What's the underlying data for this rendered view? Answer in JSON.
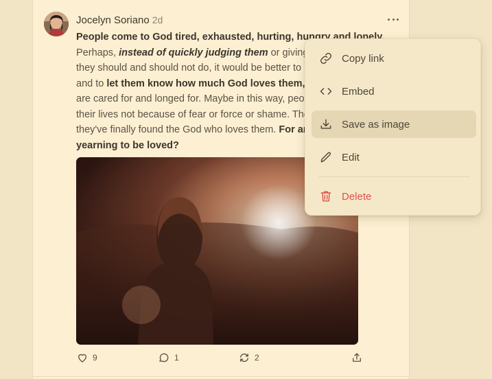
{
  "post": {
    "author": "Jocelyn Soriano",
    "time": "2d",
    "lines": [
      [
        {
          "t": "People come to God tired, exhausted, hurting, hungry and lonely.",
          "b": true,
          "i": false
        }
      ],
      [
        {
          "t": "Perhaps, ",
          "b": false,
          "i": false
        },
        {
          "t": "instead of quickly judging them",
          "b": true,
          "i": true
        },
        {
          "t": " or giving",
          "b": false,
          "i": false
        }
      ],
      [
        {
          "t": "they should and should not do, it would be better to",
          "b": false,
          "i": false
        }
      ],
      [
        {
          "t": "and to ",
          "b": false,
          "i": false
        },
        {
          "t": "let them know how much God loves them,",
          "b": true,
          "i": false
        }
      ],
      [
        {
          "t": "are cared for and longed for. Maybe in this way, peo",
          "b": false,
          "i": false
        }
      ],
      [
        {
          "t": "their lives not because of fear or force or shame. The",
          "b": false,
          "i": false
        }
      ],
      [
        {
          "t": "they've finally found the God who loves them. ",
          "b": false,
          "i": false
        },
        {
          "t": "For ar",
          "b": true,
          "i": false
        }
      ],
      [
        {
          "t": "yearning to be loved?",
          "b": true,
          "i": false
        }
      ]
    ]
  },
  "actions": {
    "likes": "9",
    "comments": "1",
    "restacks": "2"
  },
  "menu": {
    "items": [
      {
        "label": "Copy link",
        "icon": "link-icon"
      },
      {
        "label": "Embed",
        "icon": "code-icon"
      },
      {
        "label": "Save as image",
        "icon": "download-icon"
      },
      {
        "label": "Edit",
        "icon": "pencil-icon"
      },
      {
        "label": "Delete",
        "icon": "trash-icon"
      }
    ]
  },
  "colors": {
    "background": "#f2e5c6",
    "card": "#fcefd2",
    "menu": "#f5e8c9",
    "menu_hover": "#e5d7b4",
    "danger": "#e0504a"
  }
}
